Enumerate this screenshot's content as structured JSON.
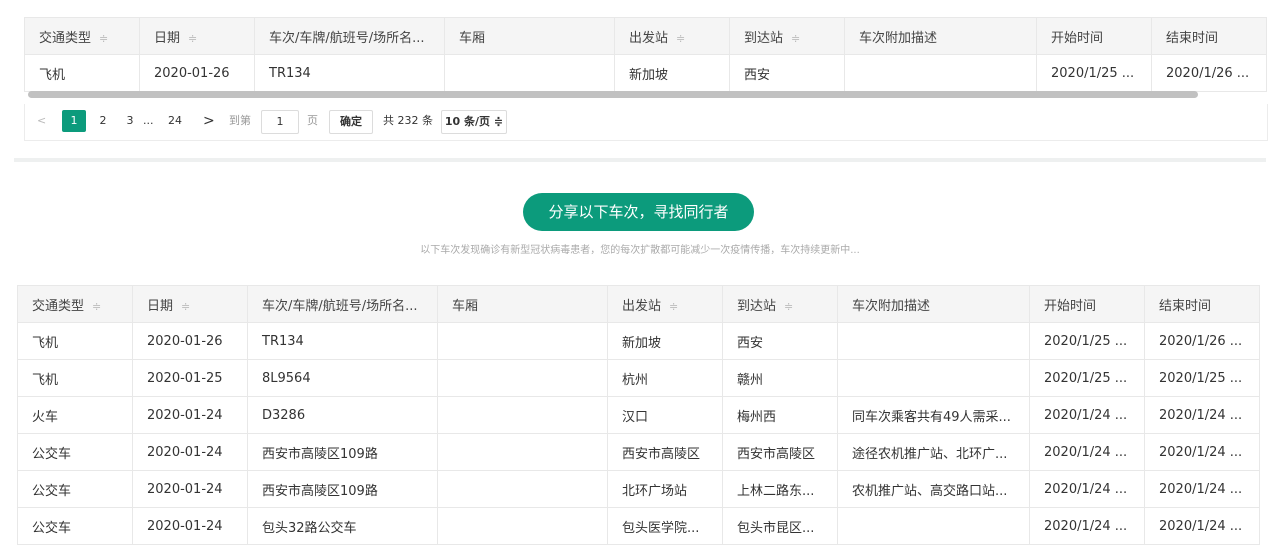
{
  "columns": [
    "交通类型",
    "日期",
    "车次/车牌/航班号/场所名...",
    "车厢",
    "出发站",
    "到达站",
    "车次附加描述",
    "开始时间",
    "结束时间"
  ],
  "table1": {
    "rows": [
      [
        "飞机",
        "2020-01-26",
        "TR134",
        "",
        "新加坡",
        "西安",
        "",
        "2020/1/25 ...",
        "2020/1/26 ..."
      ]
    ]
  },
  "pagination": {
    "prev": "<",
    "pages": [
      "1",
      "2",
      "3"
    ],
    "ellipsis": "...",
    "last": "24",
    "next": ">",
    "goto_label": "到第",
    "goto_value": "1",
    "page_unit": "页",
    "confirm": "确定",
    "total": "共 232 条",
    "page_size": "10 条/页 ≑",
    "active_page": "1"
  },
  "share": {
    "button_label": "分享以下车次，寻找同行者",
    "subtitle": "以下车次发现确诊有新型冠状病毒患者，您的每次扩散都可能减少一次疫情传播，车次持续更新中..."
  },
  "table2": {
    "rows": [
      [
        "飞机",
        "2020-01-26",
        "TR134",
        "",
        "新加坡",
        "西安",
        "",
        "2020/1/25 ...",
        "2020/1/26 ..."
      ],
      [
        "飞机",
        "2020-01-25",
        "8L9564",
        "",
        "杭州",
        "赣州",
        "",
        "2020/1/25 ...",
        "2020/1/25 ..."
      ],
      [
        "火车",
        "2020-01-24",
        "D3286",
        "",
        "汉口",
        "梅州西",
        "同车次乘客共有49人需采...",
        "2020/1/24 ...",
        "2020/1/24 ..."
      ],
      [
        "公交车",
        "2020-01-24",
        "西安市高陵区109路",
        "",
        "西安市高陵区",
        "西安市高陵区",
        "途径农机推广站、北环广...",
        "2020/1/24 ...",
        "2020/1/24 ..."
      ],
      [
        "公交车",
        "2020-01-24",
        "西安市高陵区109路",
        "",
        "北环广场站",
        "上林二路东...",
        "农机推广站、高交路口站...",
        "2020/1/24 ...",
        "2020/1/24 ..."
      ],
      [
        "公交车",
        "2020-01-24",
        "包头32路公交车",
        "",
        "包头医学院...",
        "包头市昆区...",
        "",
        "2020/1/24 ...",
        "2020/1/24 ..."
      ]
    ]
  },
  "colors": {
    "accent": "#0c9b7c"
  },
  "icons": {
    "sort": "sort-caret-icon"
  }
}
